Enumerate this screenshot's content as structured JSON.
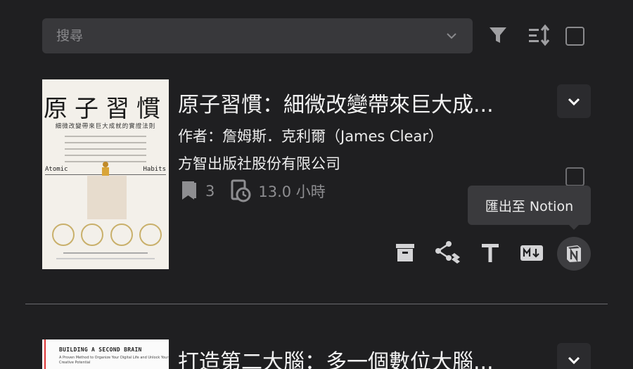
{
  "search": {
    "placeholder": "搜尋"
  },
  "toolbar": {
    "filter_icon": "filter-icon",
    "sort_icon": "sort-icon",
    "select_all_checked": false
  },
  "books": [
    {
      "title": "原子習慣：細微改變帶來巨大成...",
      "author": "作者：詹姆斯．克利爾（James Clear）",
      "publisher": "方智出版社股份有限公司",
      "highlights": "3",
      "reading_time": "13.0 小時",
      "cover": {
        "title": "原子習慣",
        "subtitle": "細微改變帶來巨大成就的實證法則",
        "en_left": "Atomic",
        "en_right": "Habits"
      }
    },
    {
      "title": "打造第二大腦：多一個數位大腦...",
      "cover": {
        "title": "BUILDING A SECOND BRAIN",
        "subtitle": "A Proven Method to Organize Your Digital Life and Unlock Your Creative Potential"
      }
    }
  ],
  "actions": {
    "archive_icon": "archive-icon",
    "share_icon": "share-dropbox-icon",
    "text_icon": "text-icon",
    "markdown_icon": "markdown-icon",
    "notion_icon": "notion-icon"
  },
  "tooltip": {
    "label": "匯出至 Notion"
  },
  "colors": {
    "background": "#1f1f21",
    "search_bg": "#38383b",
    "muted": "#8e8e91",
    "text": "#ececec"
  }
}
